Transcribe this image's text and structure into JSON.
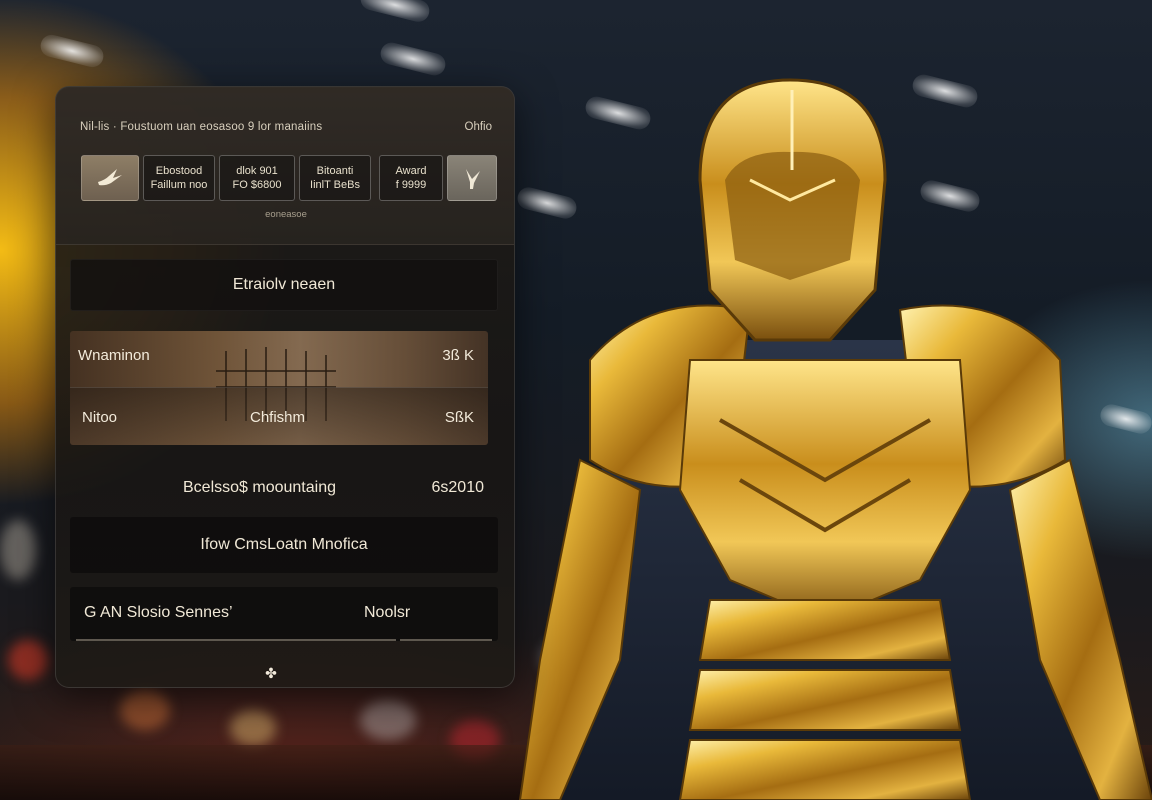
{
  "header": {
    "breadcrumb": "Nil-lis  ·  Foustuom uan  eosasoo  9  lor manaiins",
    "action_label": "Ohfio"
  },
  "tiles": [
    {
      "icon": "bird-icon"
    },
    {
      "line1": "Ebostood",
      "line2": "Faillum noo"
    },
    {
      "line1": "dlok  901",
      "line2": "FO $6800"
    },
    {
      "line1": "Bitoanti",
      "line2": "IinlT  BeBs"
    },
    {
      "line1": "Award",
      "line2": "f  9999"
    },
    {
      "icon": "gesture-icon"
    }
  ],
  "tiles_caption": "eoneasoe",
  "title_row": "Etraiolv neaen",
  "media": {
    "row1_label": "Wnaminon",
    "row1_value": "3ß K",
    "row2_label": "Nitoo",
    "row2_center": "Chfishm",
    "row2_value": "SßK"
  },
  "row_summary": {
    "label": "Bcelsso$ moountaing",
    "value": "6s2010"
  },
  "row_action": "Ifow CmsLoatn Mnofica",
  "footer": {
    "label": "G  AN  Slosio  Sennes’",
    "value": "Noolsr"
  },
  "bottom_icon": "✤",
  "colors": {
    "panel_bg": "#1c1916",
    "accent_gold": "#d9a520",
    "text": "#f0e8d6"
  }
}
